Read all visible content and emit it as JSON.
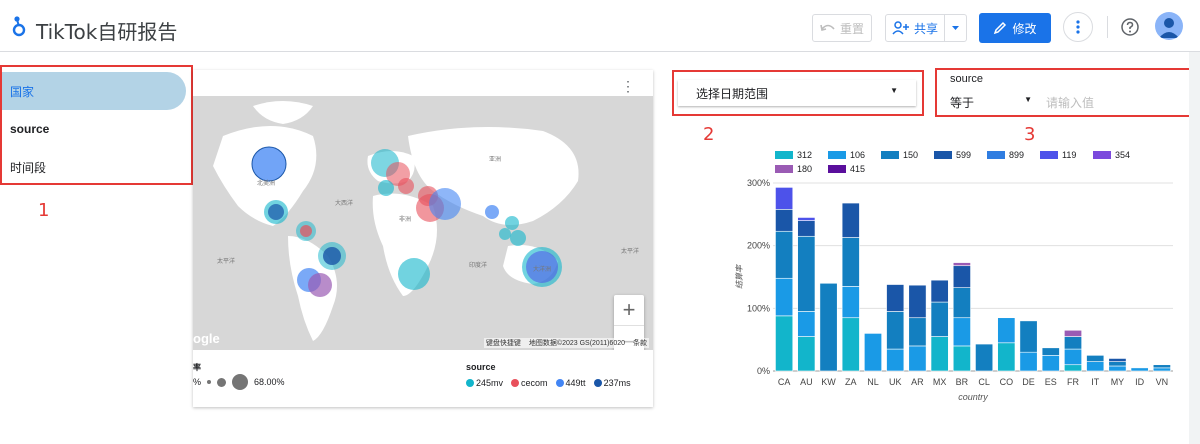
{
  "header": {
    "app_title": "TikTok自研报告",
    "reset_label": "重置",
    "share_label": "共享",
    "edit_label": "修改",
    "logo_icon": "looker-studio-logo",
    "accent_color": "#1a73e8"
  },
  "left_filters": {
    "items": [
      {
        "label": "国家"
      },
      {
        "label": "source"
      },
      {
        "label": "时间段"
      }
    ]
  },
  "annotations": {
    "label_1": "1",
    "label_2": "2",
    "label_3": "3"
  },
  "map": {
    "labels": [
      "亚洲",
      "大西洋",
      "北美洲",
      "非洲",
      "太平洋",
      "印度洋",
      "太平洋",
      "大洋洲"
    ],
    "attribution_keys": "键盘快捷键",
    "attribution_data": "地图数据©2023 GS(2011)6020",
    "attribution_terms": "条款",
    "google": "ogle",
    "zoom_in": "+",
    "zoom_out": "−",
    "legend_size_title": "率",
    "legend_size_min": "%",
    "legend_size_max": "68.00%",
    "legend_source_title": "source",
    "legend_sources": [
      {
        "label": "245mv",
        "color": "#12b5cb"
      },
      {
        "label": "cecom",
        "color": "#e8505b"
      },
      {
        "label": "449tt",
        "color": "#4285f4"
      },
      {
        "label": "237ms",
        "color": "#1a56a8"
      }
    ]
  },
  "date_filter": {
    "label": "选择日期范围"
  },
  "source_filter": {
    "title": "source",
    "operator": "等于",
    "placeholder": "请输入值"
  },
  "chart_data": {
    "type": "bar",
    "stacked": true,
    "categories": [
      "CA",
      "AU",
      "KW",
      "ZA",
      "NL",
      "UK",
      "AR",
      "MX",
      "BR",
      "CL",
      "CO",
      "DE",
      "ES",
      "FR",
      "IT",
      "MY",
      "ID",
      "VN"
    ],
    "xlabel": "country",
    "ylabel": "结算率",
    "y_ticks": [
      "0%",
      "100%",
      "200%",
      "300%"
    ],
    "ylim": [
      0,
      300
    ],
    "legend_placement": "top",
    "series": [
      {
        "name": "312",
        "color": "#12b5cb",
        "values": [
          88,
          55,
          0,
          85,
          0,
          0,
          0,
          55,
          40,
          0,
          45,
          0,
          0,
          10,
          0,
          0,
          0,
          0
        ]
      },
      {
        "name": "106",
        "color": "#1a9ae6",
        "values": [
          60,
          40,
          0,
          50,
          60,
          35,
          40,
          0,
          45,
          0,
          40,
          30,
          25,
          25,
          15,
          8,
          5,
          5
        ]
      },
      {
        "name": "150",
        "color": "#137fc0",
        "values": [
          75,
          120,
          140,
          78,
          0,
          60,
          45,
          55,
          48,
          43,
          0,
          50,
          12,
          20,
          10,
          7,
          0,
          5
        ]
      },
      {
        "name": "599",
        "color": "#1a56a8",
        "values": [
          35,
          25,
          0,
          55,
          0,
          43,
          52,
          35,
          35,
          0,
          0,
          0,
          0,
          0,
          0,
          5,
          0,
          0
        ]
      },
      {
        "name": "899",
        "color": "#2f7de1",
        "values": [
          0,
          0,
          0,
          0,
          0,
          0,
          0,
          0,
          0,
          0,
          0,
          0,
          0,
          0,
          0,
          0,
          0,
          0
        ]
      },
      {
        "name": "119",
        "color": "#4d52ea",
        "values": [
          35,
          5,
          0,
          0,
          0,
          0,
          0,
          0,
          0,
          0,
          0,
          0,
          0,
          0,
          0,
          0,
          0,
          0
        ]
      },
      {
        "name": "354",
        "color": "#7b49dd",
        "values": [
          0,
          0,
          0,
          0,
          0,
          0,
          0,
          0,
          0,
          0,
          0,
          0,
          0,
          0,
          0,
          0,
          0,
          0
        ]
      },
      {
        "name": "180",
        "color": "#9a5bb4",
        "values": [
          0,
          0,
          0,
          0,
          0,
          0,
          0,
          0,
          5,
          0,
          0,
          0,
          0,
          10,
          0,
          0,
          0,
          0
        ]
      },
      {
        "name": "415",
        "color": "#5a0f9c",
        "values": [
          0,
          0,
          0,
          0,
          0,
          0,
          0,
          0,
          0,
          0,
          0,
          0,
          0,
          0,
          0,
          0,
          0,
          0
        ]
      }
    ]
  }
}
